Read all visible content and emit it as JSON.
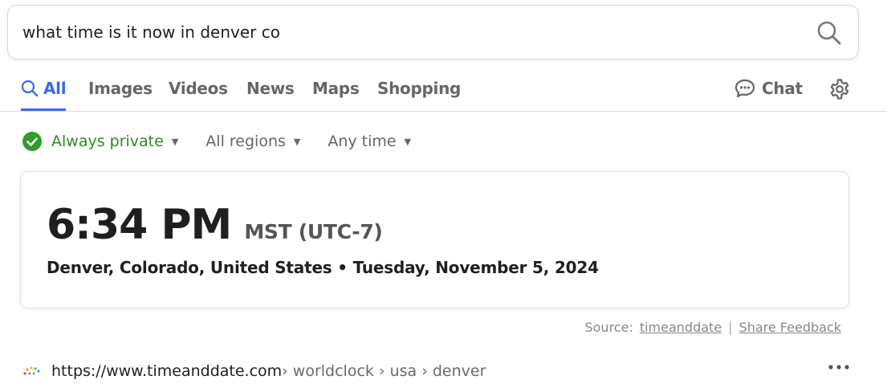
{
  "search": {
    "query": "what time is it now in denver co",
    "button_icon": "search-icon"
  },
  "tabs": [
    {
      "label": "All",
      "icon": "search-icon",
      "active": true
    },
    {
      "label": "Images"
    },
    {
      "label": "Videos"
    },
    {
      "label": "News"
    },
    {
      "label": "Maps"
    },
    {
      "label": "Shopping"
    }
  ],
  "chat": {
    "label": "Chat",
    "icon": "chat-bubble-icon"
  },
  "settings": {
    "icon": "gear-icon"
  },
  "filters": {
    "privacy": {
      "label": "Always private",
      "icon": "check-circle-icon",
      "color": "#2c8a20"
    },
    "region": {
      "label": "All regions"
    },
    "time": {
      "label": "Any time"
    }
  },
  "clock": {
    "time": "6:34 PM",
    "timezone": "MST (UTC-7)",
    "location": "Denver, Colorado, United States",
    "separator": "•",
    "date": "Tuesday, November 5, 2024"
  },
  "source": {
    "label": "Source:",
    "link": "timeanddate",
    "divider": "|",
    "feedback": "Share Feedback"
  },
  "result": {
    "domain": "https://www.timeanddate.com",
    "path": " › worldclock › usa › denver",
    "more_icon": "more-dots-icon"
  },
  "colors": {
    "accent": "#3969ef",
    "private_green": "#2c8a20"
  }
}
